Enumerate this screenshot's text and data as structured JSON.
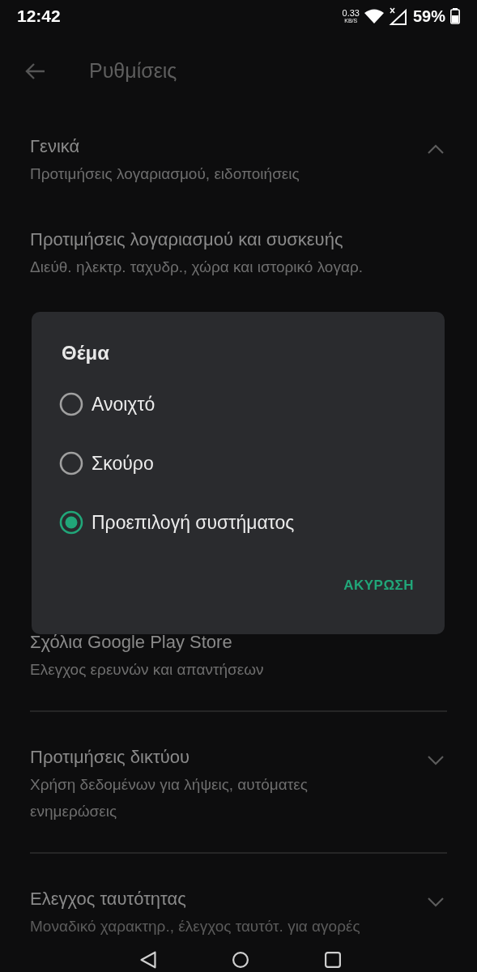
{
  "status_bar": {
    "time": "12:42",
    "net_speed": "0.33",
    "net_unit": "KB/S",
    "battery": "59%"
  },
  "header": {
    "title": "Ρυθμίσεις"
  },
  "sections": [
    {
      "title": "Γενικά",
      "subtitle": "Προτιμήσεις λογαριασμού, ειδοποιήσεις",
      "expanded": true,
      "divider": false
    },
    {
      "title": "Προτιμήσεις λογαριασμού και συσκευής",
      "subtitle": "Διεύθ. ηλεκτρ. ταχυδρ., χώρα και ιστορικό λογαρ.",
      "divider": false
    },
    {
      "title": "Σχόλια Google Play Store",
      "subtitle": "Ελεγχος ερευνών και απαντήσεων",
      "divider": true
    },
    {
      "title": "Προτιμήσεις δικτύου",
      "subtitle": "Χρήση δεδομένων για λήψεις, αυτόματες ενημερώσεις",
      "expanded": false,
      "divider": true
    },
    {
      "title": "Ελεγχος ταυτότητας",
      "subtitle": "Μοναδικό χαρακτηρ., έλεγχος ταυτότ. για αγορές",
      "expanded": false,
      "divider": false
    }
  ],
  "dialog": {
    "title": "Θέμα",
    "options": [
      {
        "label": "Ανοιχτό",
        "selected": false
      },
      {
        "label": "Σκούρο",
        "selected": false
      },
      {
        "label": "Προεπιλογή συστήματος",
        "selected": true
      }
    ],
    "button": "ΑΚΥΡΩΣΗ"
  }
}
